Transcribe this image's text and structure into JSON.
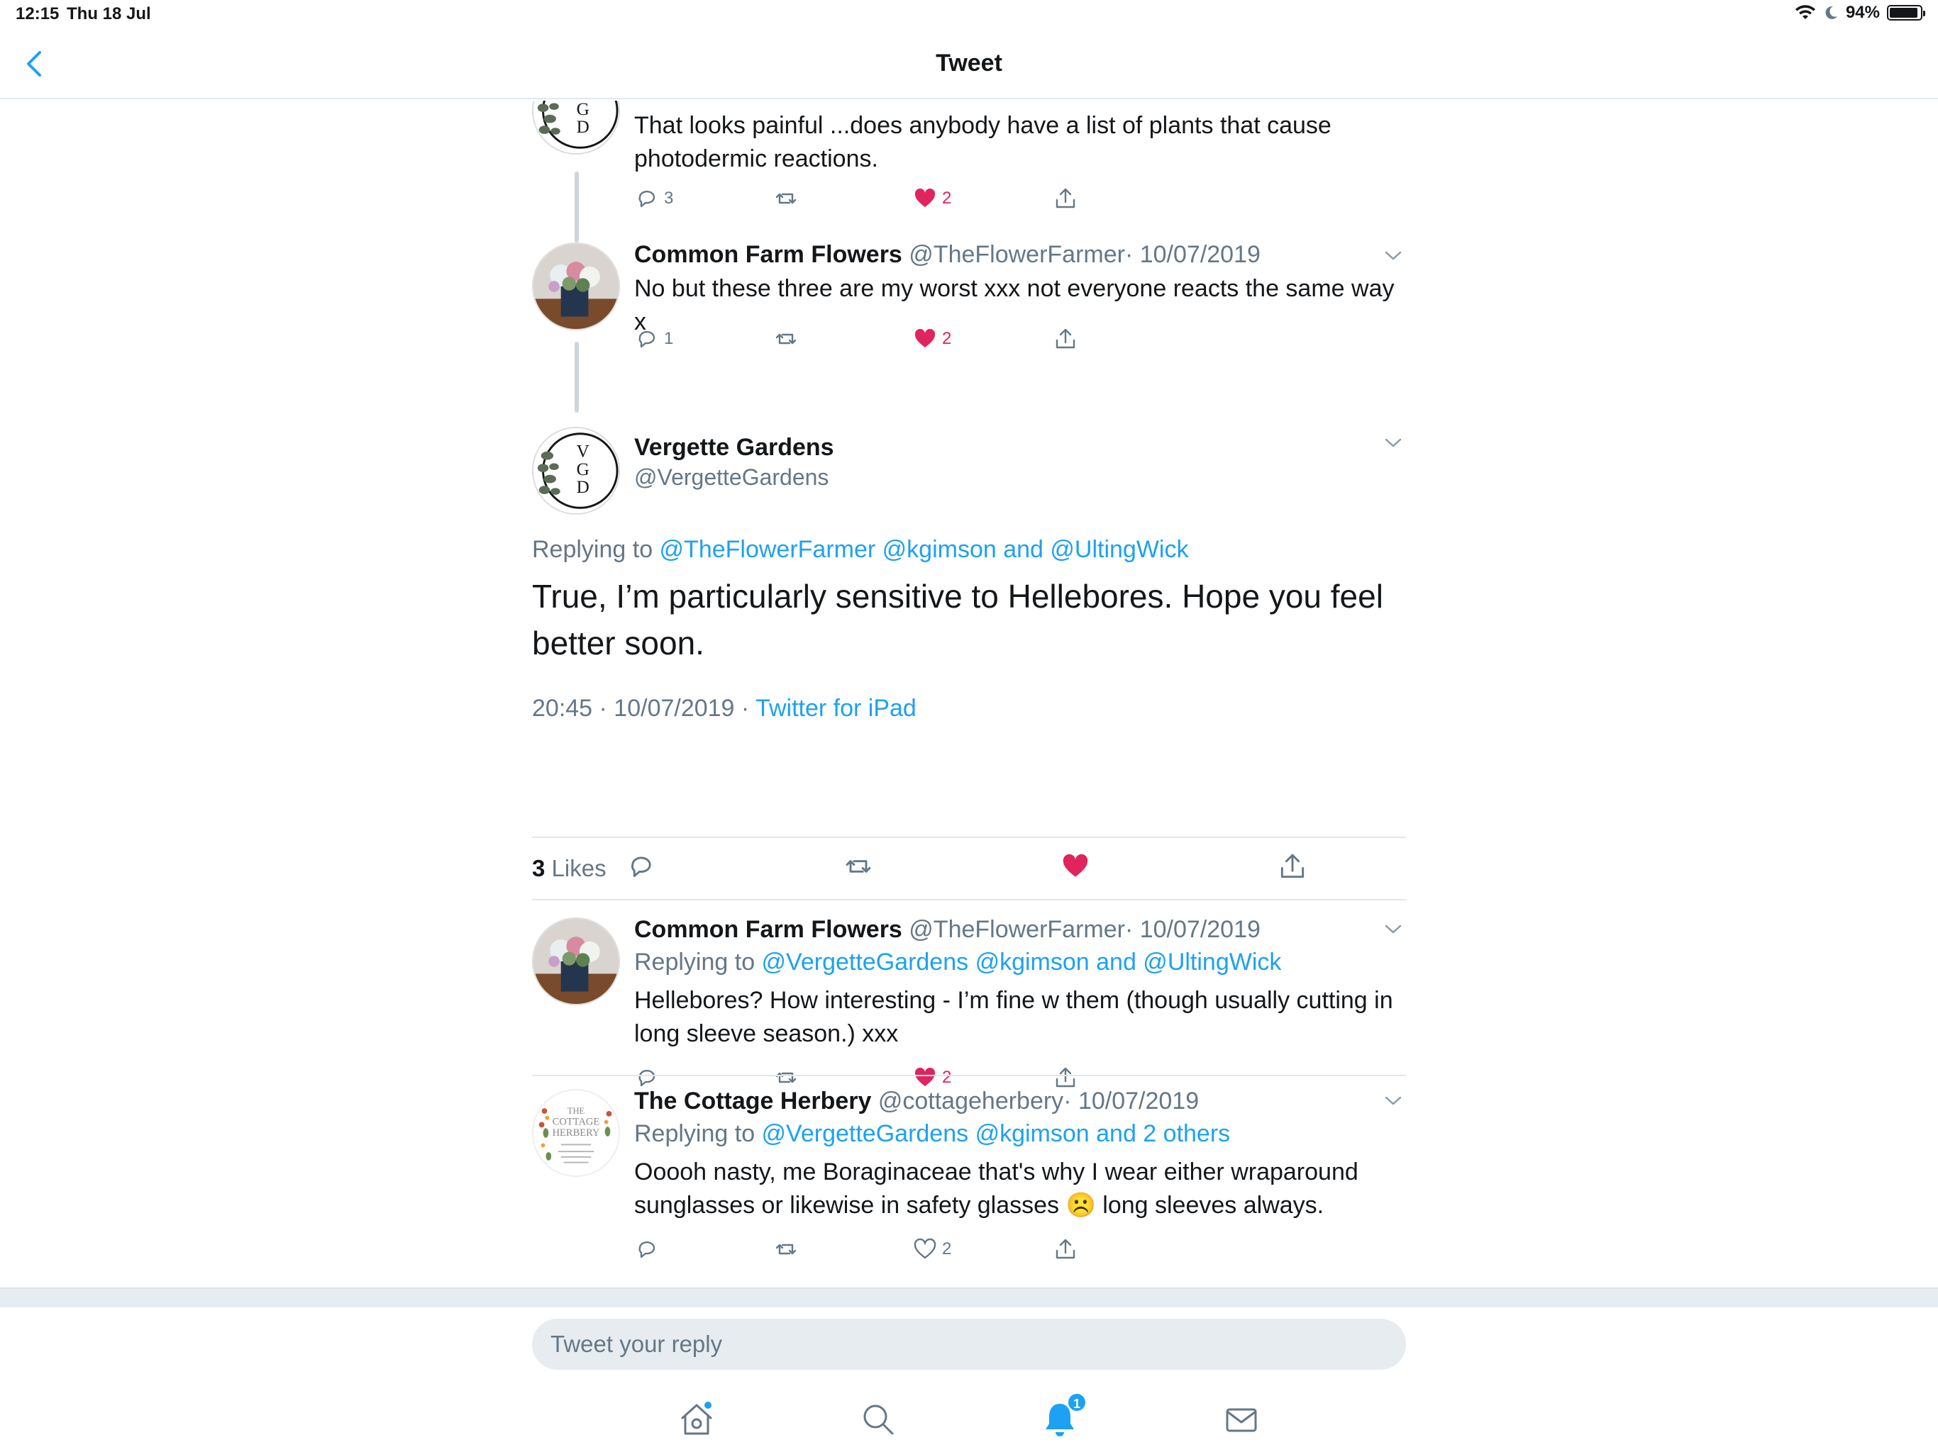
{
  "status": {
    "time": "12:15",
    "date": "Thu 18 Jul",
    "battery": "94%",
    "battery_level": 0.94
  },
  "nav": {
    "title": "Tweet"
  },
  "thread": [
    {
      "text": "That looks painful ...does anybody have a list of plants that cause photodermic reactions.",
      "replies": "3",
      "likes": "2",
      "liked": true
    },
    {
      "name": "Common Farm Flowers",
      "handle": "@TheFlowerFarmer",
      "date": "· 10/07/2019",
      "text": "No but these three are my worst xxx not everyone reacts the same way x",
      "replies": "1",
      "likes": "2",
      "liked": true
    }
  ],
  "main": {
    "name": "Vergette Gardens",
    "handle": "@VergetteGardens",
    "replying_prefix": "Replying to ",
    "replying_to": "@TheFlowerFarmer @kgimson and @UltingWick",
    "text": "True, I’m particularly sensitive to Hellebores. Hope you feel better soon.",
    "timestamp": "20:45 · 10/07/2019 · ",
    "source": "Twitter for iPad",
    "likes_count": "3",
    "likes_label": " Likes"
  },
  "replies": [
    {
      "name": "Common Farm Flowers",
      "handle": "@TheFlowerFarmer",
      "date": "· 10/07/2019",
      "replying_prefix": "Replying to ",
      "replying_to": "@VergetteGardens @kgimson and @UltingWick",
      "text": "Hellebores? How interesting - I’m fine w them (though usually cutting in long sleeve season.) xxx",
      "likes": "2",
      "liked": true
    },
    {
      "name": "The Cottage Herbery",
      "handle": "@cottageherbery",
      "date": "· 10/07/2019",
      "replying_prefix": "Replying to ",
      "replying_to": "@VergetteGardens @kgimson and 2 others",
      "text": "Ooooh nasty, me Boraginaceae that's why I wear either wraparound sunglasses or likewise in safety glasses ☹️ long sleeves always.",
      "likes": "2",
      "liked": false
    }
  ],
  "avatars": {
    "vgd_letters": [
      "V",
      "G",
      "D"
    ],
    "herbery_lines": [
      "THE",
      "COTTAGE",
      "HERBERY"
    ]
  },
  "reply_bar": {
    "placeholder": "Tweet your reply"
  },
  "tabbar": {
    "notifications_badge": "1"
  },
  "colors": {
    "accent": "#1da1f2",
    "like": "#e0245e",
    "muted": "#657786",
    "divider": "#e1e8ed"
  }
}
